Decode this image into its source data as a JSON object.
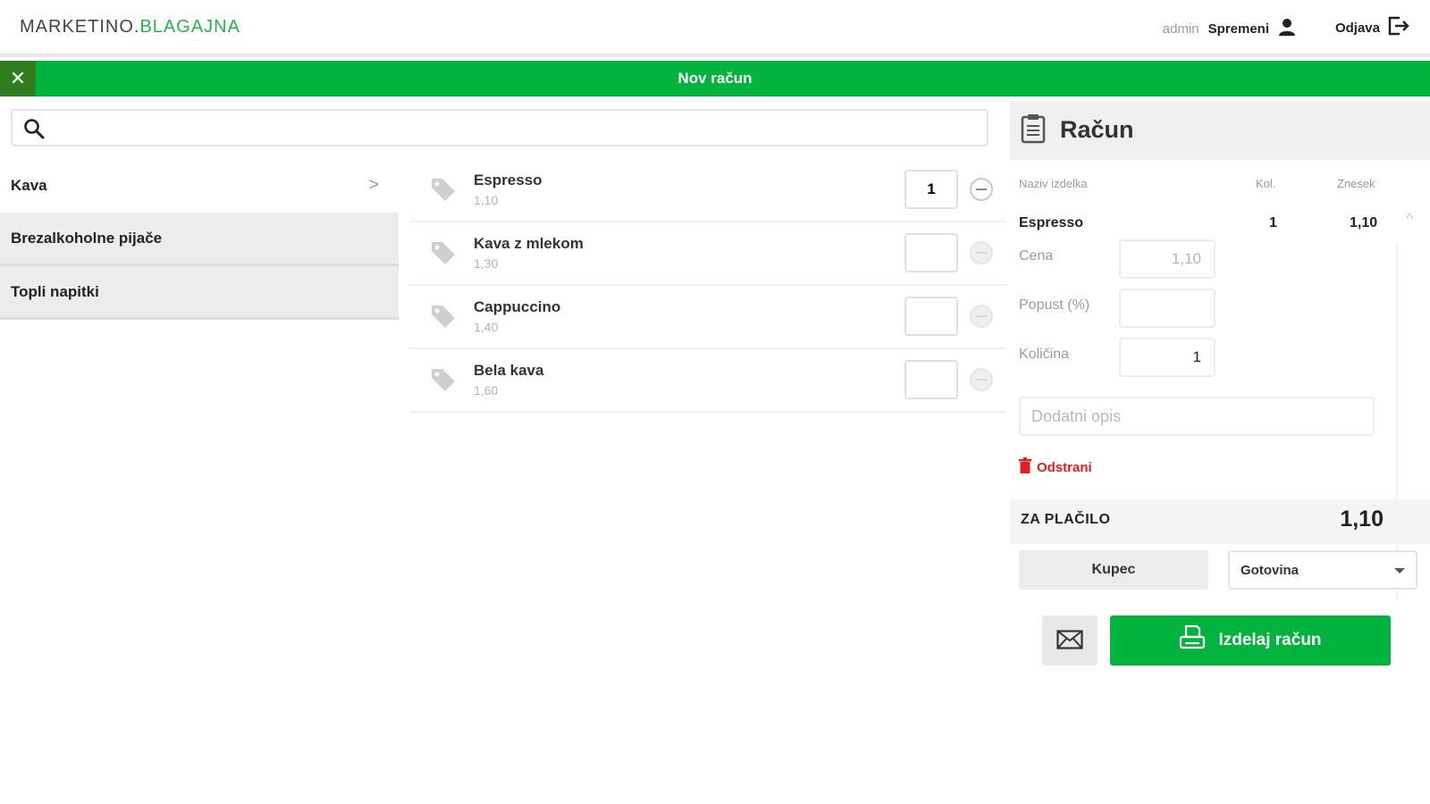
{
  "header": {
    "logo_main": "MARKETINO.",
    "logo_accent": "BLAGAJNA",
    "user_name": "admin",
    "change_label": "Spremeni",
    "logout_label": "Odjava"
  },
  "title_bar": {
    "close_symbol": "✕",
    "title": "Nov račun"
  },
  "search": {
    "placeholder": "",
    "value": ""
  },
  "categories": [
    {
      "label": "Kava",
      "active": true
    },
    {
      "label": "Brezalkoholne pijače"
    },
    {
      "label": "Topli napitki"
    }
  ],
  "category_chevron": ">",
  "products": [
    {
      "name": "Espresso",
      "price": "1,10",
      "qty": "1"
    },
    {
      "name": "Kava z mlekom",
      "price": "1,30",
      "qty": ""
    },
    {
      "name": "Cappuccino",
      "price": "1,40",
      "qty": ""
    },
    {
      "name": "Bela kava",
      "price": "1,60",
      "qty": ""
    }
  ],
  "receipt": {
    "title": "Račun",
    "columns": {
      "name": "Naziv izdelka",
      "qty": "Kol.",
      "amount": "Znesek"
    },
    "item": {
      "name": "Espresso",
      "qty": "1",
      "amount": "1,10"
    },
    "scroll_up": "^",
    "fields": {
      "price_label": "Cena",
      "price_value": "1,10",
      "discount_label": "Popust (%)",
      "discount_value": "",
      "quantity_label": "Količina",
      "quantity_value": "1"
    },
    "description_placeholder": "Dodatni opis",
    "remove_label": "Odstrani",
    "total_label": "ZA PLAČILO",
    "total_value": "1,10",
    "customer_label": "Kupec",
    "payment_method": "Gotovina",
    "issue_label": "Izdelaj račun"
  },
  "colors": {
    "brand_green": "#00b33c",
    "dark_green": "#2f7d1f",
    "danger": "#e02020"
  },
  "icons": [
    "search-icon",
    "user-icon",
    "logout-icon",
    "close-icon",
    "tag-icon",
    "minus-icon",
    "clipboard-icon",
    "trash-icon",
    "mail-icon",
    "printer-icon",
    "chevron-right-icon",
    "caret-down-icon"
  ]
}
